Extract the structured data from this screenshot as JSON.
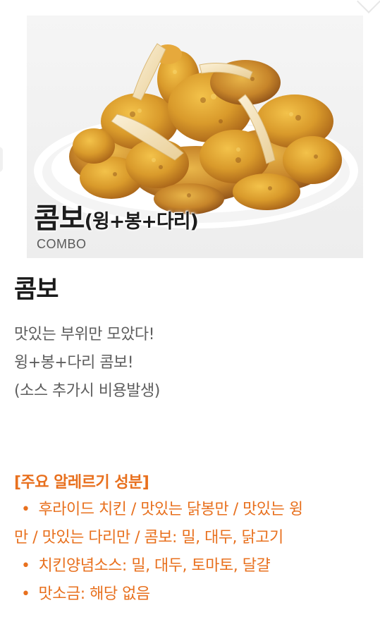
{
  "product": {
    "image_title": "콤보",
    "image_subtitle": "(윙+봉+다리)",
    "image_english": "COMBO",
    "name": "콤보",
    "description": [
      "맛있는 부위만 모았다!",
      "윙+봉+다리 콤보!",
      "(소스 추가시 비용발생)"
    ]
  },
  "allergy": {
    "title": "[주요 알레르기 성분]",
    "items": [
      {
        "bullet": "•",
        "line1": "후라이드 치킨 / 맛있는 닭봉만 / 맛있는 윙",
        "line2": "만 / 맛있는 다리만 / 콤보: 밀, 대두, 닭고기"
      },
      {
        "bullet": "•",
        "text": "치킨양념소스: 밀, 대두, 토마토, 달걀"
      },
      {
        "bullet": "•",
        "text": "맛소금: 해당 없음"
      }
    ]
  },
  "colors": {
    "accent": "#e8701e",
    "title": "#1a1a1a",
    "body_text": "#5e5e5e"
  }
}
